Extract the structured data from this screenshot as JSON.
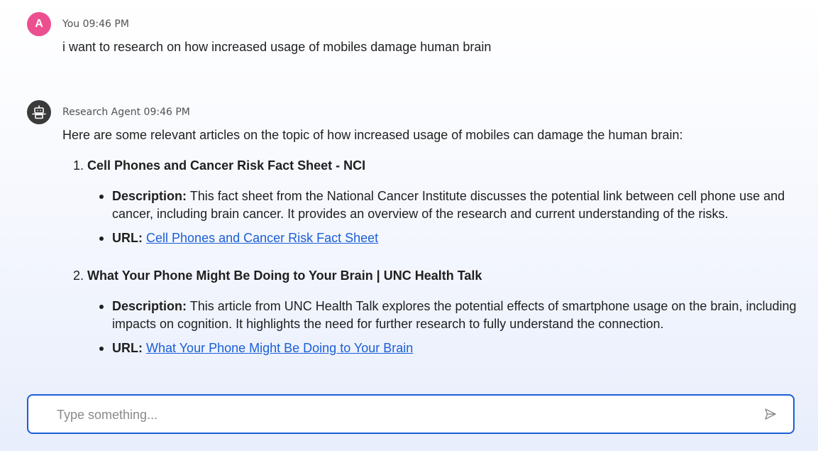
{
  "messages": {
    "user": {
      "avatar_letter": "A",
      "meta": "You 09:46 PM",
      "text": "i want to research on how increased usage of mobiles damage human brain"
    },
    "agent": {
      "meta": "Research Agent 09:46 PM",
      "intro": "Here are some relevant articles on the topic of how increased usage of mobiles can damage the human brain:",
      "articles": [
        {
          "number": "1.",
          "title": "Cell Phones and Cancer Risk Fact Sheet - NCI",
          "description_label": "Description:",
          "description": "This fact sheet from the National Cancer Institute discusses the potential link between cell phone use and cancer, including brain cancer. It provides an overview of the research and current understanding of the risks.",
          "url_label": "URL:",
          "url_text": "Cell Phones and Cancer Risk Fact Sheet"
        },
        {
          "number": "2.",
          "title": "What Your Phone Might Be Doing to Your Brain | UNC Health Talk",
          "description_label": "Description:",
          "description": "This article from UNC Health Talk explores the potential effects of smartphone usage on the brain, including impacts on cognition. It highlights the need for further research to fully understand the connection.",
          "url_label": "URL:",
          "url_text": "What Your Phone Might Be Doing to Your Brain"
        }
      ]
    }
  },
  "composer": {
    "placeholder": "Type something..."
  },
  "icons": {
    "agent_avatar": "robot-icon",
    "send": "send-icon"
  },
  "colors": {
    "user_avatar": "#ec4f8f",
    "agent_avatar": "#3a3a3a",
    "accent": "#1a5fd6"
  }
}
